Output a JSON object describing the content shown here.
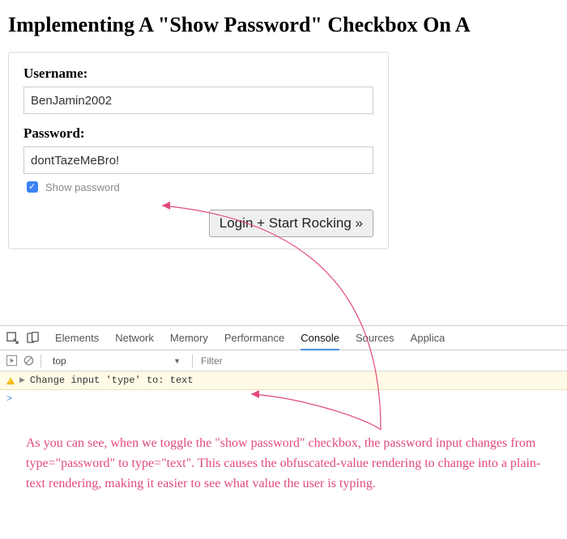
{
  "page": {
    "title": "Implementing A \"Show Password\" Checkbox On A"
  },
  "form": {
    "username_label": "Username:",
    "username_value": "BenJamin2002",
    "password_label": "Password:",
    "password_value": "dontTazeMeBro!",
    "show_password_label": "Show password",
    "show_password_checked": true,
    "submit_label": "Login + Start Rocking »"
  },
  "devtools": {
    "tabs": [
      "Elements",
      "Network",
      "Memory",
      "Performance",
      "Console",
      "Sources",
      "Applica"
    ],
    "active_tab": "Console",
    "context": "top",
    "filter_placeholder": "Filter",
    "log_message": "Change input 'type' to: text",
    "prompt": ">"
  },
  "annotation": {
    "text": "As you can see, when we toggle the \"show password\" checkbox, the password input changes from type=\"password\" to type=\"text\". This causes the obfuscated-value rendering to change into a plain-text rendering, making it easier to see what value the user is typing."
  }
}
